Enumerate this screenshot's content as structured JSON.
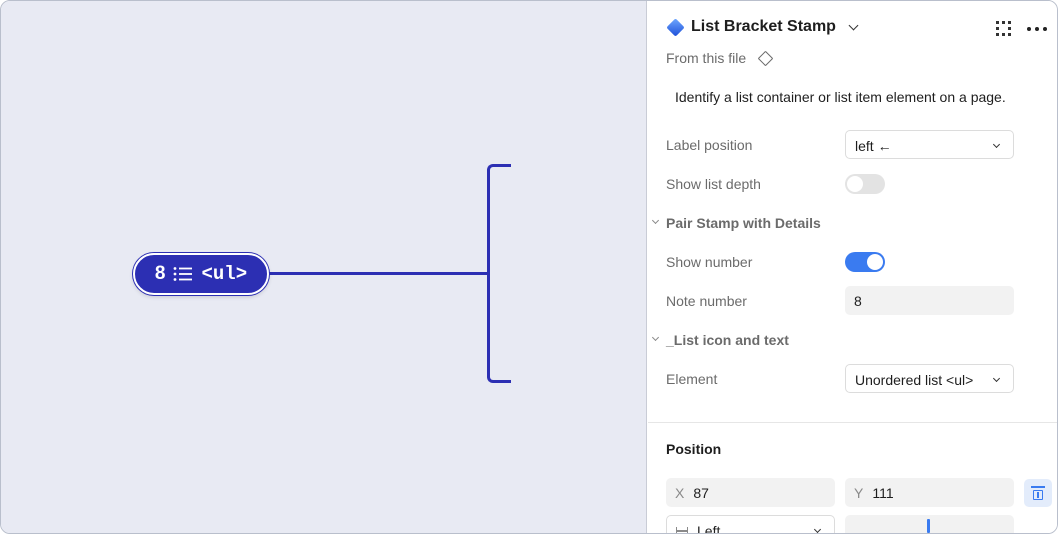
{
  "canvas": {
    "stamp": {
      "number": "8",
      "icon": "list-icon",
      "element_text": "<ul>"
    },
    "colors": {
      "stamp": "#2c2fb3",
      "canvas_bg": "#e8eaf3"
    }
  },
  "panel": {
    "header": {
      "title": "List Bracket Stamp",
      "icon": "component-diamond-icon"
    },
    "from_file": "From this file",
    "description": "Identify a list container or list item element on a page.",
    "label_position": {
      "label": "Label position",
      "value": "left ←"
    },
    "show_list_depth": {
      "label": "Show list depth",
      "on": false
    },
    "section_pair": "Pair Stamp with Details",
    "show_number": {
      "label": "Show number",
      "on": true
    },
    "note_number": {
      "label": "Note number",
      "value": "8"
    },
    "section_list": "_List icon and text",
    "element": {
      "label": "Element",
      "value": "Unordered list <ul>"
    },
    "position": {
      "title": "Position",
      "x_prefix": "X",
      "x": "87",
      "y_prefix": "Y",
      "y": "111",
      "horizontal": "Left"
    },
    "colors": {
      "accent": "#3a7bf0"
    }
  }
}
